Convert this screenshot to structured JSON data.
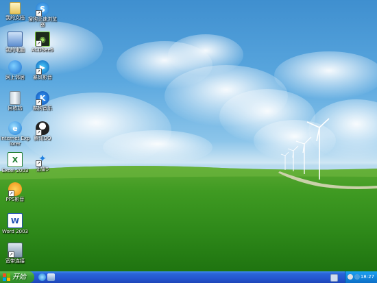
{
  "desktop": {
    "icons": [
      {
        "label": "我的文档",
        "icon": "my-documents-icon"
      },
      {
        "label": "搜狗高速浏览器",
        "icon": "sogou-browser-icon"
      },
      {
        "label": "我的电脑",
        "icon": "my-computer-icon"
      },
      {
        "label": "ACDSee5",
        "icon": "acdsee-icon"
      },
      {
        "label": "网上邻居",
        "icon": "network-places-icon"
      },
      {
        "label": "暴风影音",
        "icon": "storm-player-icon"
      },
      {
        "label": "回收站",
        "icon": "recycle-bin-icon"
      },
      {
        "label": "酷狗音乐",
        "icon": "kugou-music-icon"
      },
      {
        "label": "Internet Explorer",
        "icon": "internet-explorer-icon"
      },
      {
        "label": "腾讯QQ",
        "icon": "qq-icon"
      },
      {
        "label": "Excel 2003",
        "icon": "excel-icon"
      },
      {
        "label": "迅雷5",
        "icon": "thunder-icon"
      },
      {
        "label": "PPS影音",
        "icon": "pps-player-icon"
      },
      {
        "label": "Word 2003",
        "icon": "word-icon"
      },
      {
        "label": "宽带连接",
        "icon": "broadband-connection-icon"
      }
    ]
  },
  "taskbar": {
    "start_label": "开始",
    "quick_launch": [
      "ie-quicklaunch-icon",
      "show-desktop-icon"
    ],
    "clock": "18:27"
  }
}
